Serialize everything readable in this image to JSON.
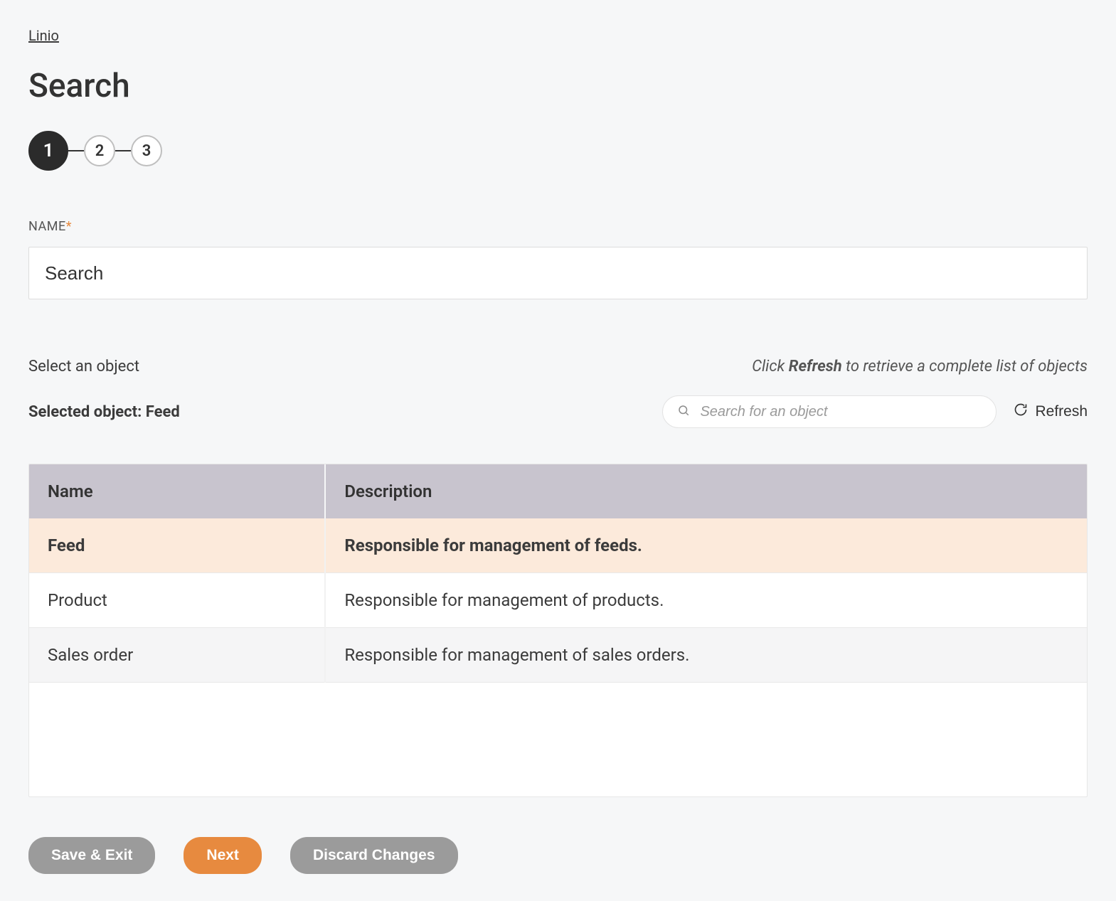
{
  "breadcrumb": {
    "label": "Linio"
  },
  "page": {
    "title": "Search"
  },
  "stepper": {
    "steps": [
      "1",
      "2",
      "3"
    ],
    "activeIndex": 0
  },
  "form": {
    "name_label": "NAME",
    "name_value": "Search"
  },
  "objectSection": {
    "select_prompt": "Select an object",
    "hint_prefix": "Click ",
    "hint_bold": "Refresh",
    "hint_suffix": " to retrieve a complete list of objects",
    "selected_prefix": "Selected object: ",
    "selected_value": "Feed",
    "search_placeholder": "Search for an object",
    "refresh_label": "Refresh"
  },
  "table": {
    "headers": {
      "name": "Name",
      "description": "Description"
    },
    "rows": [
      {
        "name": "Feed",
        "description": "Responsible for management of feeds.",
        "selected": true
      },
      {
        "name": "Product",
        "description": "Responsible for management of products.",
        "selected": false
      },
      {
        "name": "Sales order",
        "description": "Responsible for management of sales orders.",
        "selected": false
      }
    ]
  },
  "footer": {
    "save_exit": "Save & Exit",
    "next": "Next",
    "discard": "Discard Changes"
  }
}
